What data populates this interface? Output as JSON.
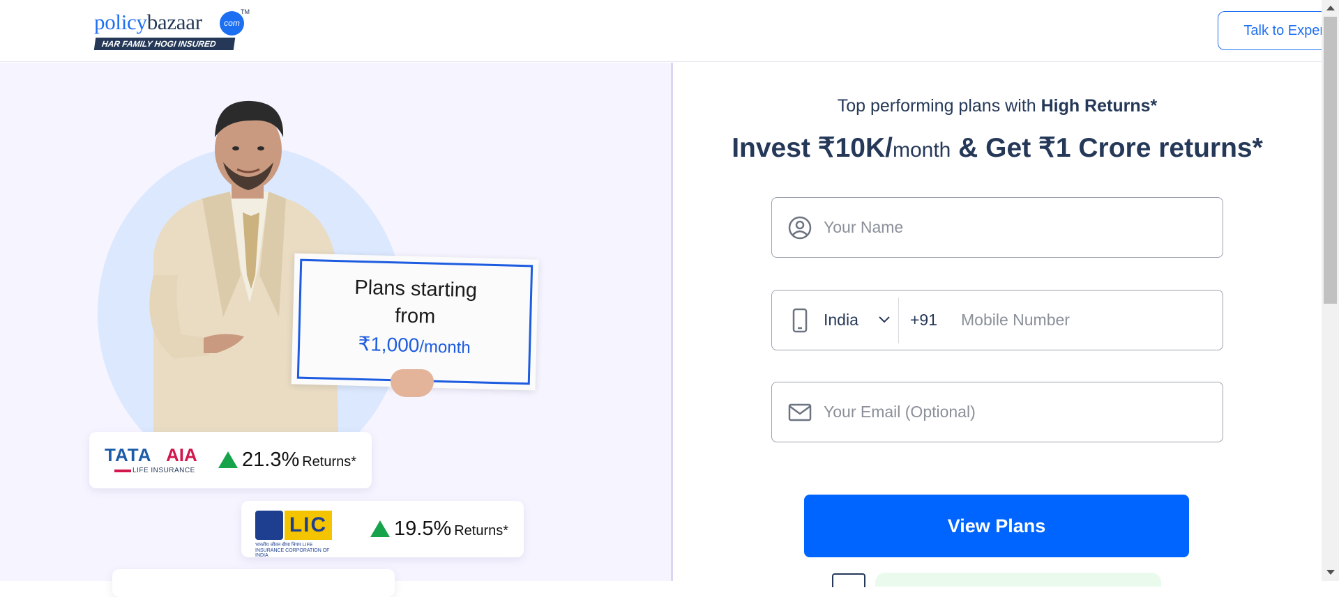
{
  "header": {
    "logo": {
      "word_part1": "policy",
      "word_part2": "bazaar",
      "com": "com",
      "tm": "TM",
      "tagline": "HAR FAMILY HOGI INSURED"
    },
    "talk_button": "Talk to Expert"
  },
  "hero": {
    "sign": {
      "line1": "Plans starting",
      "line2": "from",
      "amount": "₹1,000",
      "per": "/month"
    },
    "insurers": [
      {
        "brand_word1": "TATA",
        "brand_word2": "AIA",
        "brand_sub": "LIFE INSURANCE",
        "returns_value": "21.3%",
        "returns_label": "Returns*"
      },
      {
        "brand_word1": "LIC",
        "brand_sub": "भारतीय जीवन बीमा निगम LIFE INSURANCE CORPORATION OF INDIA",
        "returns_value": "19.5%",
        "returns_label": "Returns*"
      }
    ]
  },
  "form": {
    "subtitle_prefix": "Top performing plans with",
    "subtitle_bold": "High Returns*",
    "headline_part1": "Invest ₹10K/",
    "headline_small": "month",
    "headline_part2": " & Get ₹1 Crore returns*",
    "name_placeholder": "Your Name",
    "country": "India",
    "country_code": "+91",
    "mobile_placeholder": "Mobile Number",
    "email_placeholder": "Your Email (Optional)",
    "submit": "View Plans",
    "icons": {
      "name": "user-circle-icon",
      "mobile": "mobile-phone-icon",
      "email": "mail-icon",
      "dropdown": "chevron-down-icon"
    }
  },
  "colors": {
    "brand_blue": "#0065ff",
    "navy": "#253858",
    "left_bg": "#f6f4ff",
    "positive": "#16a34a"
  }
}
